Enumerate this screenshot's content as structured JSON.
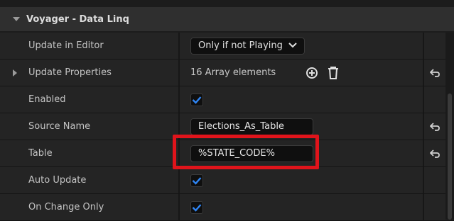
{
  "section": {
    "title": "Voyager - Data Linq"
  },
  "rows": [
    {
      "label": "Update in Editor",
      "dropdown_value": "Only if not Playing"
    },
    {
      "label": "Update Properties",
      "array_text": "16 Array elements"
    },
    {
      "label": "Enabled",
      "checked": true
    },
    {
      "label": "Source Name",
      "input_value": "Elections_As_Table"
    },
    {
      "label": "Table",
      "input_value": "%STATE_CODE%"
    },
    {
      "label": "Auto Update",
      "checked": true
    },
    {
      "label": "On Change Only",
      "checked": true
    }
  ],
  "colors": {
    "accent": "#2f86f6",
    "highlight": "#e0141b"
  }
}
